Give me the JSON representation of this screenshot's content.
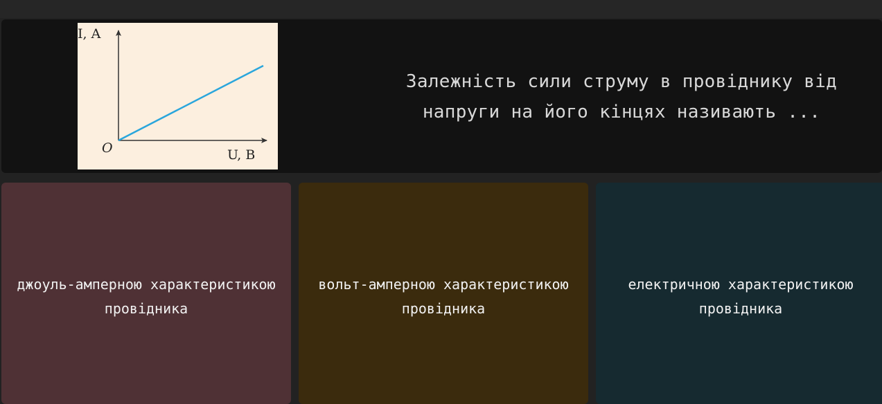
{
  "question": {
    "text": "Залежність сили струму в провіднику від напруги на його кінцях називають ...",
    "graph": {
      "y_axis_label": "I, A",
      "x_axis_label": "U, B",
      "origin_label": "O",
      "line_color": "#2aa6dc",
      "background_color": "#fcefdf"
    }
  },
  "answers": [
    {
      "label": "джоуль-амперною характеристикою провідника",
      "color": "#4f3135"
    },
    {
      "label": "вольт-амперною характеристикою провідника",
      "color": "#3b2b0d"
    },
    {
      "label": "електричною характеристикою провідника",
      "color": "#162a30"
    }
  ]
}
